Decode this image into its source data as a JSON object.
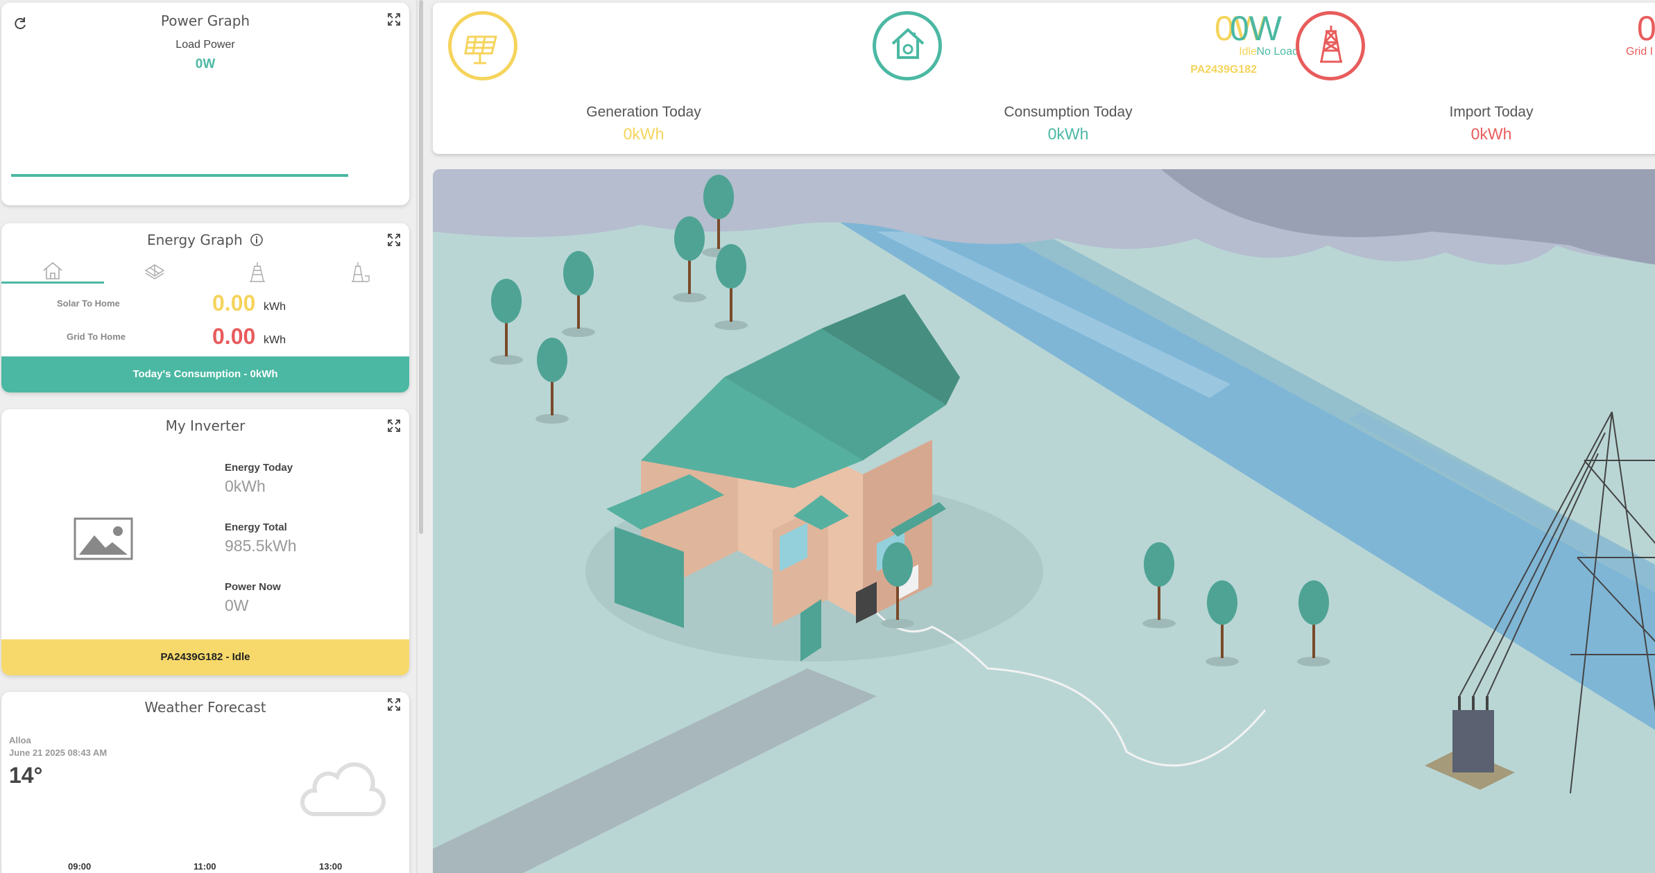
{
  "power_graph": {
    "title": "Power Graph",
    "label": "Load Power",
    "value": "0W"
  },
  "energy_graph": {
    "title": "Energy Graph",
    "tabs": [
      "home-icon",
      "solar-panel-icon",
      "inverter-tower-icon",
      "grid-tower-icon"
    ],
    "rows": [
      {
        "label": "Solar To Home",
        "value": "0.00",
        "unit": "kWh",
        "color": "#f5d45c"
      },
      {
        "label": "Grid To Home",
        "value": "0.00",
        "unit": "kWh",
        "color": "#e85c5c"
      }
    ],
    "footer": "Today's Consumption - 0kWh"
  },
  "inverter": {
    "title": "My Inverter",
    "stats": [
      {
        "label": "Energy Today",
        "value": "0kWh"
      },
      {
        "label": "Energy Total",
        "value": "985.5kWh"
      },
      {
        "label": "Power Now",
        "value": "0W"
      }
    ],
    "footer": "PA2439G182 - Idle"
  },
  "weather": {
    "title": "Weather Forecast",
    "location": "Alloa",
    "date": "June 21 2025 08:43 AM",
    "temp": "14°",
    "hours": [
      "09:00",
      "11:00",
      "13:00"
    ]
  },
  "summary": {
    "solar": {
      "value": "0W",
      "status": "Idle",
      "serial": "PA2439G182",
      "color": "#f5d45c"
    },
    "home": {
      "value": "0W",
      "status": "No Load",
      "color": "#4bb8a3"
    },
    "grid": {
      "value": "0",
      "status": "Grid I",
      "color": "#e85c5c"
    },
    "stats": [
      {
        "label": "Generation Today",
        "value": "0kWh",
        "color": "#f5d45c"
      },
      {
        "label": "Consumption Today",
        "value": "0kWh",
        "color": "#4bb8a3"
      },
      {
        "label": "Import Today",
        "value": "0kWh",
        "color": "#e85c5c"
      }
    ]
  }
}
